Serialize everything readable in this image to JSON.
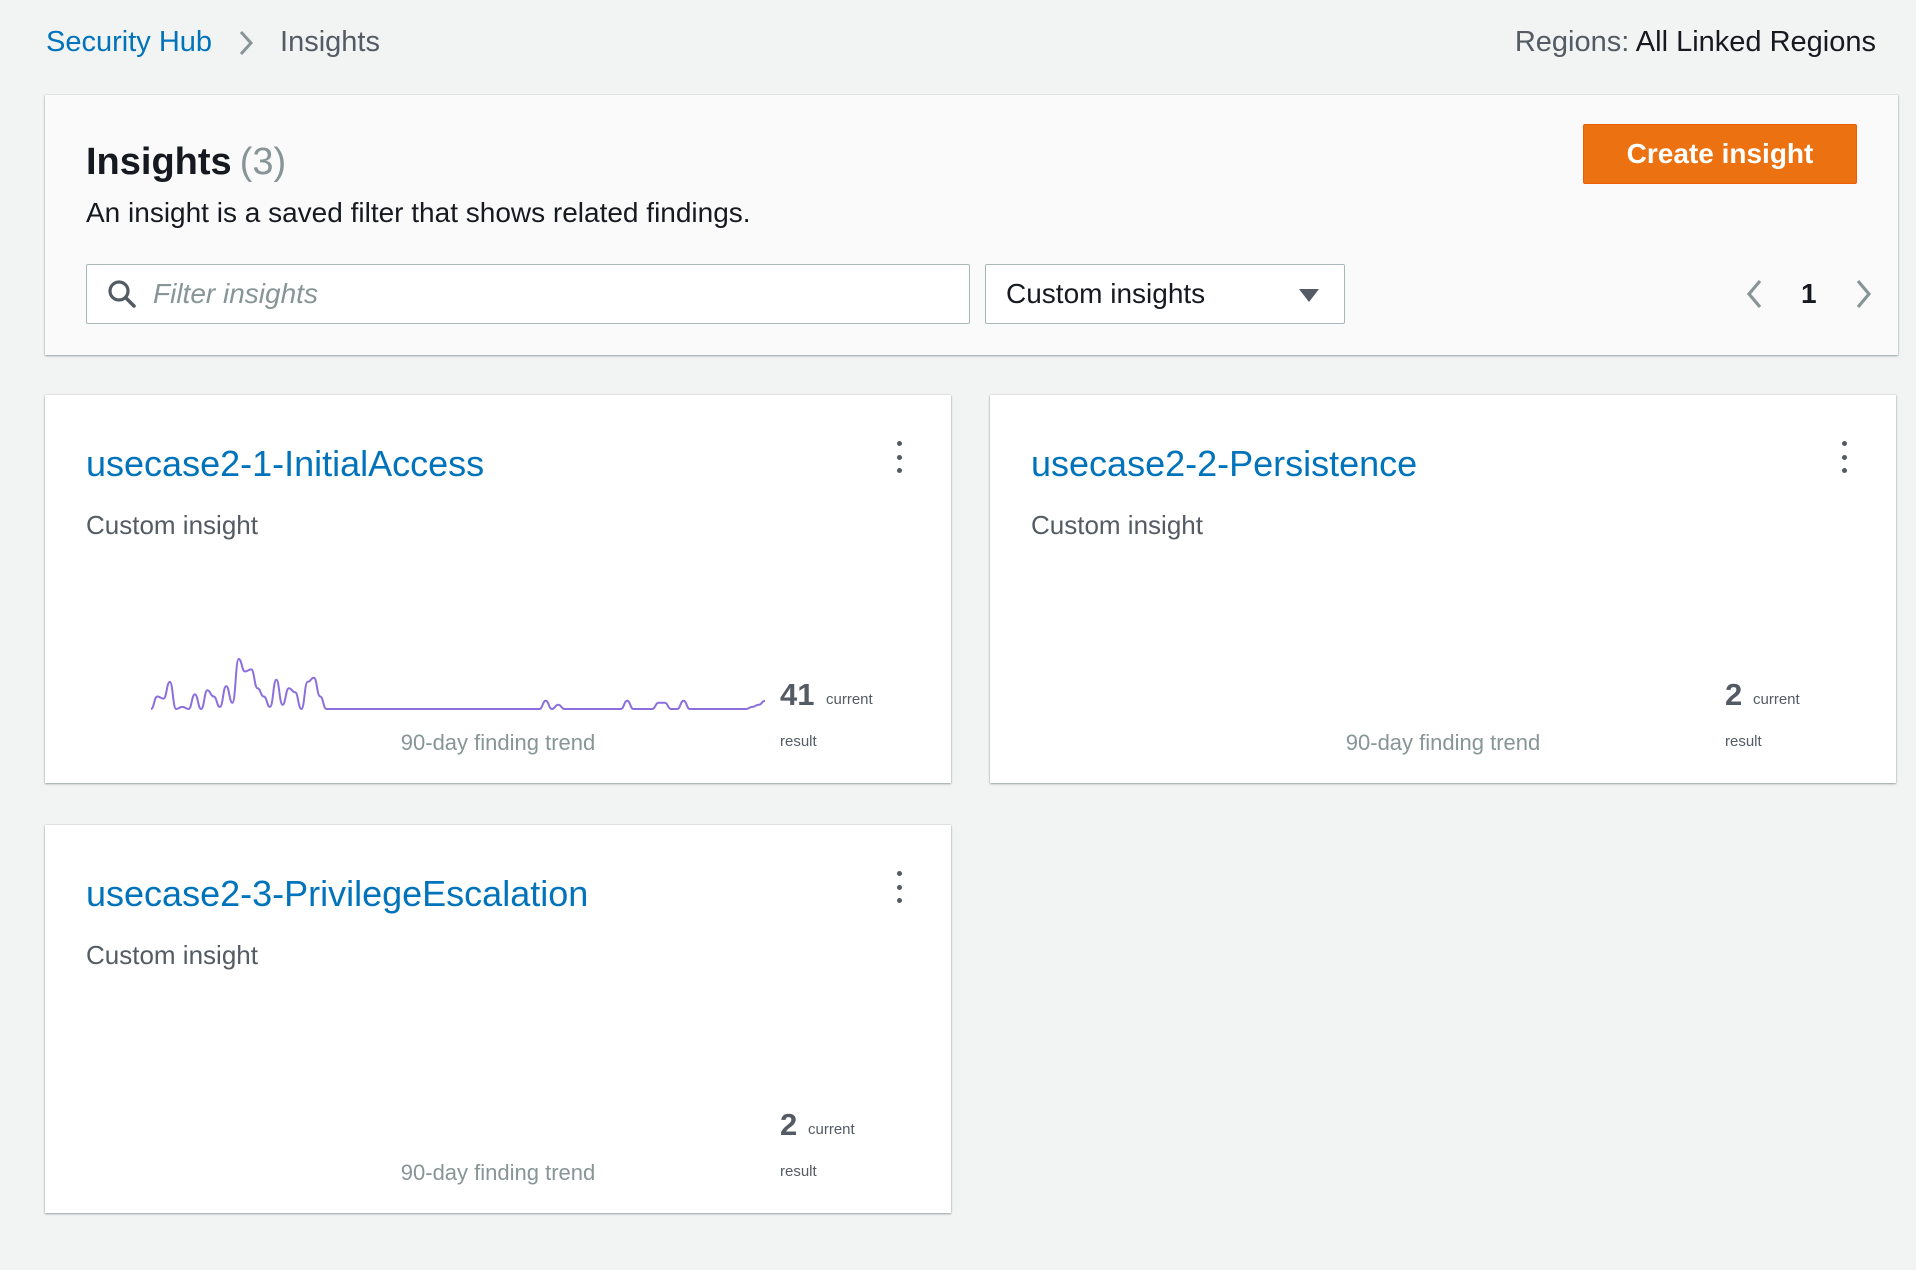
{
  "breadcrumb": {
    "root": "Security Hub",
    "current": "Insights"
  },
  "regions": {
    "label": "Regions:",
    "value": "All Linked Regions"
  },
  "header": {
    "title": "Insights",
    "count": "(3)",
    "description": "An insight is a saved filter that shows related findings.",
    "create_button": "Create insight",
    "search_placeholder": "Filter insights",
    "filter_select": "Custom insights",
    "page": "1"
  },
  "cards": [
    {
      "title": "usecase2-1-InitialAccess",
      "subtitle": "Custom insight",
      "trend_label": "90-day finding trend",
      "count": "41",
      "count_current": "current",
      "count_result": "result",
      "trend": [
        0,
        6,
        5,
        13,
        0,
        1,
        0,
        7,
        0,
        9,
        6,
        1,
        11,
        3,
        24,
        18,
        19,
        10,
        6,
        1,
        14,
        2,
        10,
        8,
        0,
        13,
        15,
        6,
        0,
        0,
        0,
        0,
        0,
        0,
        0,
        0,
        0,
        0,
        0,
        0,
        0,
        0,
        0,
        0,
        0,
        0,
        0,
        0,
        0,
        0,
        0,
        0,
        0,
        0,
        0,
        0,
        0,
        0,
        0,
        0,
        0,
        0,
        0,
        4,
        0,
        2,
        0,
        0,
        0,
        0,
        0,
        0,
        0,
        0,
        0,
        0,
        4,
        0,
        0,
        0,
        0,
        3,
        3,
        0,
        0,
        4,
        0,
        0,
        0,
        0,
        0,
        0,
        0,
        0,
        0,
        0,
        1,
        2,
        4
      ]
    },
    {
      "title": "usecase2-2-Persistence",
      "subtitle": "Custom insight",
      "trend_label": "90-day finding trend",
      "count": "2",
      "count_current": "current",
      "count_result": "result",
      "trend": []
    },
    {
      "title": "usecase2-3-PrivilegeEscalation",
      "subtitle": "Custom insight",
      "trend_label": "90-day finding trend",
      "count": "2",
      "count_current": "current",
      "count_result": "result",
      "trend": []
    }
  ],
  "colors": {
    "link": "#0073bb",
    "primary_button": "#ec7211",
    "trend_line": "#8b6fdc",
    "background": "#f2f3f3"
  },
  "icons": {
    "breadcrumb_separator": "chevron-right-icon",
    "search": "search-icon",
    "select_caret": "caret-down-icon",
    "prev": "chevron-left-icon",
    "next": "chevron-right-icon",
    "menu": "kebab-menu-icon"
  }
}
